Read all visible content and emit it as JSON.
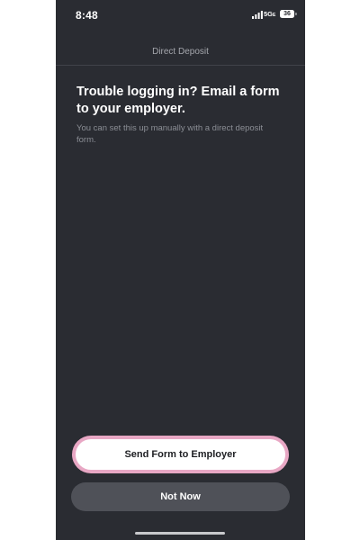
{
  "status_bar": {
    "time": "8:48",
    "network": "5G",
    "network_suffix": "E",
    "battery": "36"
  },
  "header": {
    "title": "Direct Deposit"
  },
  "content": {
    "headline": "Trouble logging in? Email a form to your employer.",
    "subtext": "You can set this up manually with a direct deposit form."
  },
  "actions": {
    "primary_label": "Send Form to Employer",
    "secondary_label": "Not Now"
  },
  "colors": {
    "background": "#2a2c32",
    "primary_button": "#ffffff",
    "primary_highlight": "#e8a7c4",
    "secondary_button": "#4f5158"
  },
  "icons": {
    "signal": "cellular-signal-icon",
    "battery": "battery-icon"
  }
}
